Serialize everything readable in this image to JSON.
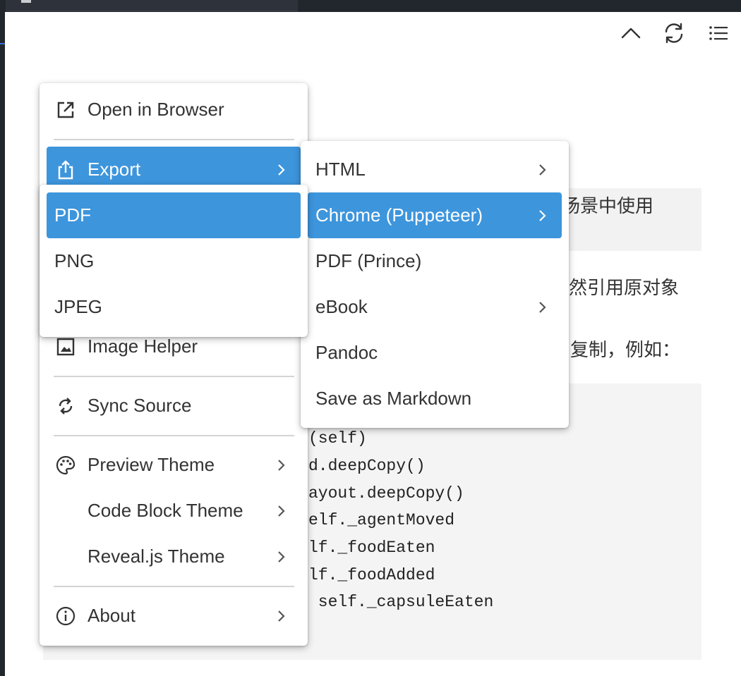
{
  "toolbar": {
    "collapse_icon": "chevron-up-icon",
    "refresh_icon": "refresh-icon",
    "toc_icon": "list-icon"
  },
  "background": {
    "para1_fragment": "场景中使用",
    "para2_fragment": "然引用原对象",
    "para3_fragment": "复制，例如：",
    "code_lines": [
      "(self)",
      "d.deepCopy()",
      "ayout.deepCopy()",
      "elf._agentMoved",
      "lf._foodEaten",
      "lf._foodAdded",
      " self._capsuleEaten"
    ]
  },
  "main_menu": {
    "items": [
      {
        "label": "Open in Browser",
        "icon": "open-external-icon"
      },
      {
        "label": "Export",
        "icon": "share-icon",
        "selected": true
      },
      {
        "label": "Image Helper",
        "icon": "image-icon"
      },
      {
        "label": "Sync Source",
        "icon": "sync-icon"
      },
      {
        "label": "Preview Theme",
        "icon": "palette-icon"
      },
      {
        "label": "Code Block Theme"
      },
      {
        "label": "Reveal.js Theme"
      },
      {
        "label": "About",
        "icon": "info-icon"
      }
    ]
  },
  "export_menu": {
    "items": [
      {
        "label": "HTML"
      },
      {
        "label": "Chrome (Puppeteer)",
        "selected": true
      },
      {
        "label": "PDF (Prince)"
      },
      {
        "label": "eBook"
      },
      {
        "label": "Pandoc"
      },
      {
        "label": "Save as Markdown"
      }
    ]
  },
  "puppeteer_menu": {
    "items": [
      {
        "label": "PDF",
        "selected": true
      },
      {
        "label": "PNG"
      },
      {
        "label": "JPEG"
      }
    ]
  },
  "colors": {
    "selection": "#3d95dc",
    "menu_bg": "#ffffff",
    "text": "#333333",
    "chrome_dark": "#22262d"
  }
}
